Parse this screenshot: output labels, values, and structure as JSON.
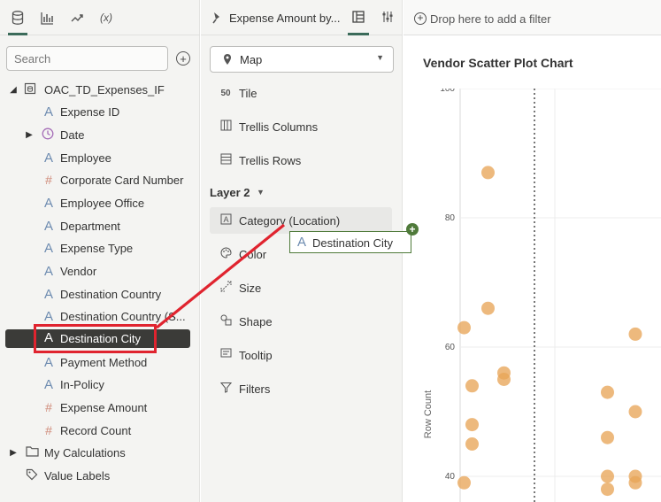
{
  "left_panel": {
    "tabs": [
      {
        "icon": "database-icon"
      },
      {
        "icon": "bar-chart-icon"
      },
      {
        "icon": "trend-icon"
      },
      {
        "icon": "function-icon",
        "label": "(x)"
      }
    ],
    "search_placeholder": "Search",
    "tree": [
      {
        "label": "OAC_TD_Expenses_IF",
        "type": "dataset",
        "caret": "expanded"
      },
      {
        "label": "Expense ID",
        "type": "attribute"
      },
      {
        "label": "Date",
        "type": "time",
        "caret": "collapsed"
      },
      {
        "label": "Employee",
        "type": "attribute"
      },
      {
        "label": "Corporate Card Number",
        "type": "measure"
      },
      {
        "label": "Employee Office",
        "type": "attribute"
      },
      {
        "label": "Department",
        "type": "attribute"
      },
      {
        "label": "Expense Type",
        "type": "attribute"
      },
      {
        "label": "Vendor",
        "type": "attribute"
      },
      {
        "label": "Destination Country",
        "type": "attribute"
      },
      {
        "label": "Destination Country (S...",
        "type": "attribute"
      },
      {
        "label": "Destination City",
        "type": "attribute",
        "selected": true
      },
      {
        "label": "Payment Method",
        "type": "attribute"
      },
      {
        "label": "In-Policy",
        "type": "attribute"
      },
      {
        "label": "Expense Amount",
        "type": "measure"
      },
      {
        "label": "Record Count",
        "type": "measure"
      },
      {
        "label": "My Calculations",
        "type": "folder",
        "caret": "collapsed"
      },
      {
        "label": "Value Labels",
        "type": "tag"
      }
    ]
  },
  "middle_panel": {
    "tab_title": "Expense Amount by...",
    "viz_type": "Map",
    "grammar": [
      "Tile",
      "Trellis Columns",
      "Trellis Rows"
    ],
    "layer_label": "Layer 2",
    "layer_items": [
      "Category (Location)",
      "Color",
      "Size",
      "Shape",
      "Tooltip",
      "Filters"
    ],
    "drag_chip_label": "Destination City"
  },
  "right_panel": {
    "filter_placeholder": "Drop here to add a filter",
    "chart_title": "Vendor Scatter Plot Chart"
  },
  "chart_data": {
    "type": "scatter",
    "title": "Vendor Scatter Plot Chart",
    "ylabel": "Row Count",
    "xlabel": "",
    "ylim": [
      35,
      100
    ],
    "yticks": [
      100,
      80,
      60,
      40
    ],
    "grid": true,
    "color": "#e8a558",
    "points": [
      {
        "x": 0.7,
        "y": 87
      },
      {
        "x": 0.7,
        "y": 66
      },
      {
        "x": 0.1,
        "y": 63
      },
      {
        "x": 0.3,
        "y": 54
      },
      {
        "x": 1.1,
        "y": 56
      },
      {
        "x": 1.1,
        "y": 55
      },
      {
        "x": 0.3,
        "y": 48
      },
      {
        "x": 0.3,
        "y": 45
      },
      {
        "x": 0.1,
        "y": 39
      },
      {
        "x": 4.4,
        "y": 62
      },
      {
        "x": 3.7,
        "y": 53
      },
      {
        "x": 4.4,
        "y": 50
      },
      {
        "x": 3.7,
        "y": 46
      },
      {
        "x": 3.7,
        "y": 40
      },
      {
        "x": 3.7,
        "y": 38
      },
      {
        "x": 4.4,
        "y": 40
      },
      {
        "x": 4.4,
        "y": 39
      }
    ]
  },
  "colors": {
    "accent": "#3b6b5a",
    "selected_bg": "#3b3b38",
    "highlight_red": "#e0242f",
    "drop_green": "#4f7a3a",
    "point": "#e8a558"
  }
}
